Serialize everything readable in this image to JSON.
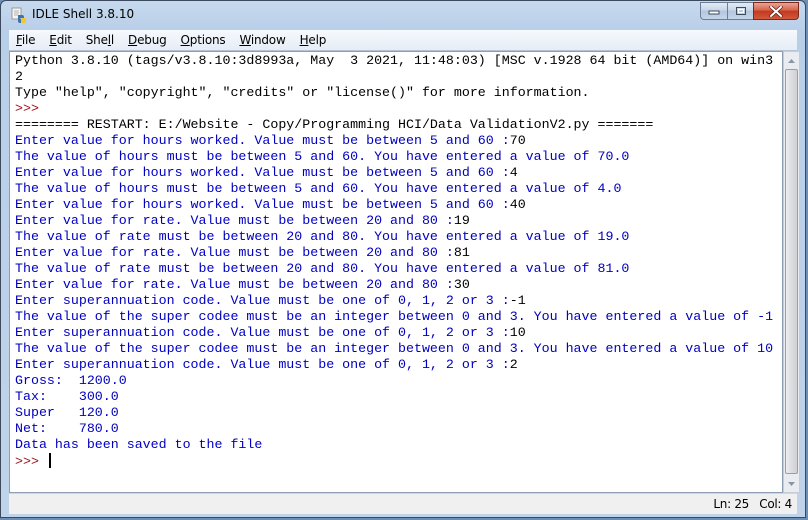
{
  "window": {
    "title": "IDLE Shell 3.8.10",
    "app_icon": "python-idle-icon",
    "controls": {
      "minimize": "minimize-icon",
      "maximize": "maximize-icon",
      "close": "close-icon"
    }
  },
  "menubar": {
    "items": [
      {
        "label": "File",
        "mnemonic": "F"
      },
      {
        "label": "Edit",
        "mnemonic": "E"
      },
      {
        "label": "Shell",
        "mnemonic": "l"
      },
      {
        "label": "Debug",
        "mnemonic": "D"
      },
      {
        "label": "Options",
        "mnemonic": "O"
      },
      {
        "label": "Window",
        "mnemonic": "W"
      },
      {
        "label": "Help",
        "mnemonic": "H"
      }
    ]
  },
  "shell": {
    "lines": [
      {
        "type": "out",
        "text": "Python 3.8.10 (tags/v3.8.10:3d8993a, May  3 2021, 11:48:03) [MSC v.1928 64 bit (AMD64)] on win3"
      },
      {
        "type": "out",
        "text": "2"
      },
      {
        "type": "out",
        "text": "Type \"help\", \"copyright\", \"credits\" or \"license()\" for more information."
      },
      {
        "type": "prompt",
        "text": ">>> "
      },
      {
        "type": "restart",
        "text": "======== RESTART: E:/Website - Copy/Programming HCI/Data ValidationV2.py ======="
      },
      {
        "type": "stdout",
        "text": "Enter value for hours worked. Value must be between 5 and 60 :",
        "input": "70"
      },
      {
        "type": "stdout",
        "text": "The value of hours must be between 5 and 60. You have entered a value of 70.0"
      },
      {
        "type": "stdout",
        "text": "Enter value for hours worked. Value must be between 5 and 60 :",
        "input": "4"
      },
      {
        "type": "stdout",
        "text": "The value of hours must be between 5 and 60. You have entered a value of 4.0"
      },
      {
        "type": "stdout",
        "text": "Enter value for hours worked. Value must be between 5 and 60 :",
        "input": "40"
      },
      {
        "type": "stdout",
        "text": "Enter value for rate. Value must be between 20 and 80 :",
        "input": "19"
      },
      {
        "type": "stdout",
        "text": "The value of rate must be between 20 and 80. You have entered a value of 19.0"
      },
      {
        "type": "stdout",
        "text": "Enter value for rate. Value must be between 20 and 80 :",
        "input": "81"
      },
      {
        "type": "stdout",
        "text": "The value of rate must be between 20 and 80. You have entered a value of 81.0"
      },
      {
        "type": "stdout",
        "text": "Enter value for rate. Value must be between 20 and 80 :",
        "input": "30"
      },
      {
        "type": "stdout",
        "text": "Enter superannuation code. Value must be one of 0, 1, 2 or 3 :",
        "input": "-1"
      },
      {
        "type": "stdout",
        "text": "The value of the super codee must be an integer between 0 and 3. You have entered a value of -1"
      },
      {
        "type": "stdout",
        "text": "Enter superannuation code. Value must be one of 0, 1, 2 or 3 :",
        "input": "10"
      },
      {
        "type": "stdout",
        "text": "The value of the super codee must be an integer between 0 and 3. You have entered a value of 10"
      },
      {
        "type": "stdout",
        "text": "Enter superannuation code. Value must be one of 0, 1, 2 or 3 :",
        "input": "2"
      },
      {
        "type": "stdout",
        "text": "Gross:  1200.0"
      },
      {
        "type": "stdout",
        "text": "Tax:    300.0"
      },
      {
        "type": "stdout",
        "text": "Super   120.0"
      },
      {
        "type": "stdout",
        "text": "Net:    780.0"
      },
      {
        "type": "stdout",
        "text": "Data has been saved to the file"
      },
      {
        "type": "prompt",
        "text": ">>> ",
        "cursor": true
      }
    ]
  },
  "scrollbar": {
    "up_icon": "scroll-up-arrow-icon",
    "down_icon": "scroll-down-arrow-icon"
  },
  "statusbar": {
    "line": "Ln: 25",
    "col": "Col: 4"
  }
}
